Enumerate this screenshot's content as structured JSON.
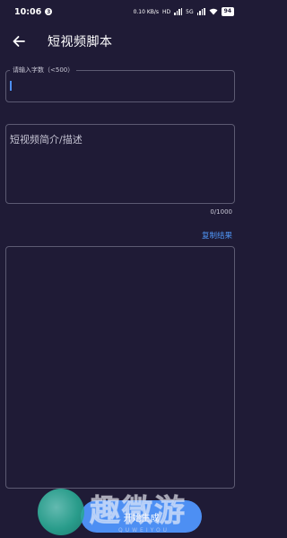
{
  "status_bar": {
    "time": "10:06",
    "notification_badge": "3",
    "speed": "0.10 KB/s",
    "network": "5G",
    "battery": "94"
  },
  "app_bar": {
    "title": "短视频脚本"
  },
  "word_count_field": {
    "label": "请输入字数（<500）",
    "value": ""
  },
  "description_field": {
    "placeholder": "短视频简介/描述",
    "counter": "0/1000"
  },
  "copy_result": "复制结果",
  "generate_button": "开始生成",
  "watermark": {
    "text": "趣微游",
    "subtext": "QUWEIYOU"
  },
  "colors": {
    "background": "#1f1b36",
    "accent": "#4d8ff3",
    "border": "#5c5a72"
  }
}
